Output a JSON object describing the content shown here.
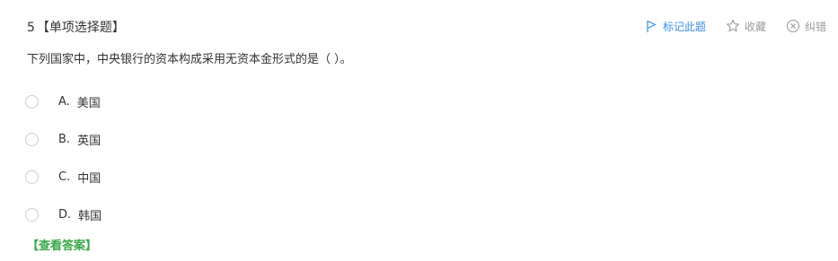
{
  "question": {
    "number": "5",
    "type_label": "【单项选择题】",
    "stem": "下列国家中，中央银行的资本构成采用无资本金形式的是（    ）。",
    "options": [
      {
        "letter": "A.",
        "text": "美国"
      },
      {
        "letter": "B.",
        "text": "英国"
      },
      {
        "letter": "C.",
        "text": "中国"
      },
      {
        "letter": "D.",
        "text": "韩国"
      }
    ]
  },
  "actions": {
    "mark_label": "标记此题",
    "favorite_label": "收藏",
    "report_label": "纠错"
  },
  "answer_link": "【查看答案】",
  "colors": {
    "accent_blue": "#3a8ee6",
    "answer_green": "#3aa84a",
    "muted_gray": "#9a9a9a"
  },
  "icons": {
    "mark": "flag-icon",
    "favorite": "star-icon",
    "report": "circle-x-icon"
  }
}
